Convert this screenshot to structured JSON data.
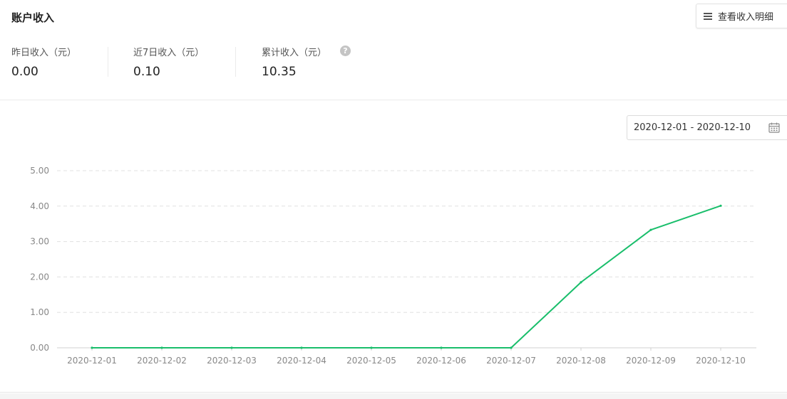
{
  "header": {
    "title": "账户收入",
    "detail_button": "查看收入明细",
    "detail_icon": "list-icon"
  },
  "stats": [
    {
      "label": "昨日收入（元）",
      "value": "0.00"
    },
    {
      "label": "近7日收入（元）",
      "value": "0.10"
    },
    {
      "label": "累计收入（元）",
      "value": "10.35"
    }
  ],
  "help_icon": {
    "name": "question-circle-icon",
    "glyph": "?"
  },
  "date_filter": {
    "value": "2020-12-01 - 2020-12-10",
    "icon": "calendar-icon"
  },
  "colors": {
    "line": "#19be6b",
    "grid": "#e0e0e0",
    "axis_text": "#888888"
  },
  "chart_data": {
    "type": "line",
    "title": "",
    "xlabel": "",
    "ylabel": "",
    "categories": [
      "2020-12-01",
      "2020-12-02",
      "2020-12-03",
      "2020-12-04",
      "2020-12-05",
      "2020-12-06",
      "2020-12-07",
      "2020-12-08",
      "2020-12-09",
      "2020-12-10"
    ],
    "series": [
      {
        "values": [
          0,
          0,
          0,
          0,
          0,
          0,
          0,
          1.85,
          3.33,
          4.01
        ]
      }
    ],
    "y_ticks": [
      "0.00",
      "1.00",
      "2.00",
      "3.00",
      "4.00",
      "5.00"
    ],
    "ylim": [
      0,
      5
    ],
    "grid": true,
    "grid_style": "dashed"
  }
}
